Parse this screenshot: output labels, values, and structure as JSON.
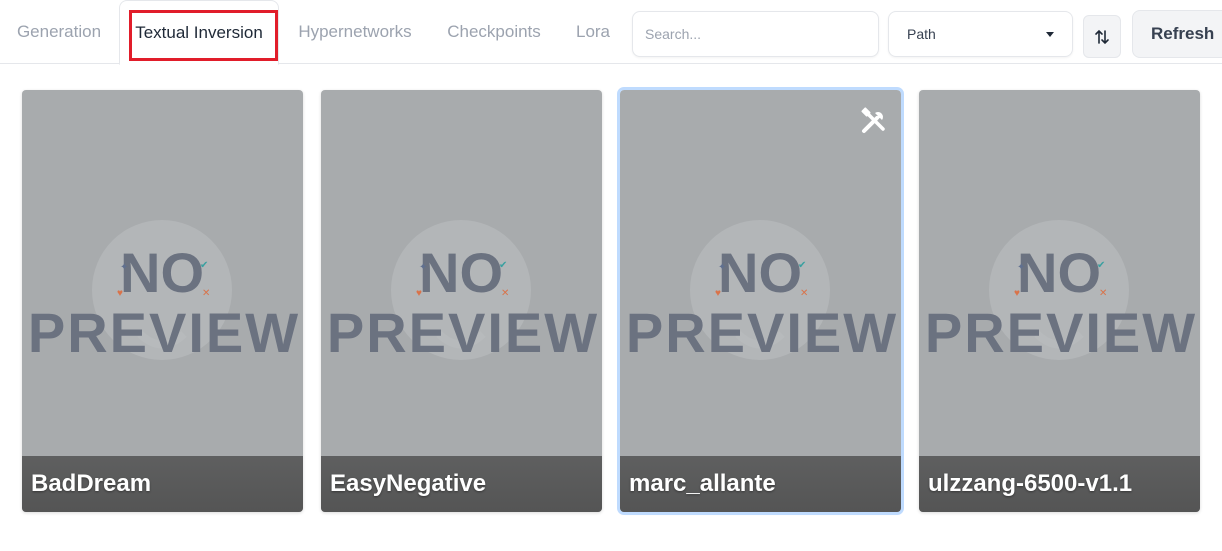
{
  "tabs": [
    {
      "label": "Generation",
      "active": false
    },
    {
      "label": "Textual Inversion",
      "active": true
    },
    {
      "label": "Hypernetworks",
      "active": false
    },
    {
      "label": "Checkpoints",
      "active": false
    },
    {
      "label": "Lora",
      "active": false
    }
  ],
  "search": {
    "placeholder": "Search...",
    "value": ""
  },
  "sort_select": {
    "value": "Path"
  },
  "sort_toggle_icon": "sort-arrows-icon",
  "refresh_label": "Refresh",
  "preview_text": {
    "line1": "NO",
    "line2": "PREVIEW"
  },
  "cards": [
    {
      "name": "BadDream",
      "selected": false
    },
    {
      "name": "EasyNegative",
      "selected": false
    },
    {
      "name": "marc_allante",
      "selected": true
    },
    {
      "name": "ulzzang-6500-v1.1",
      "selected": false
    }
  ],
  "colors": {
    "highlight": "#e11d2a",
    "card_bg": "#a8abad",
    "selected_outline": "#bfdbfe"
  }
}
